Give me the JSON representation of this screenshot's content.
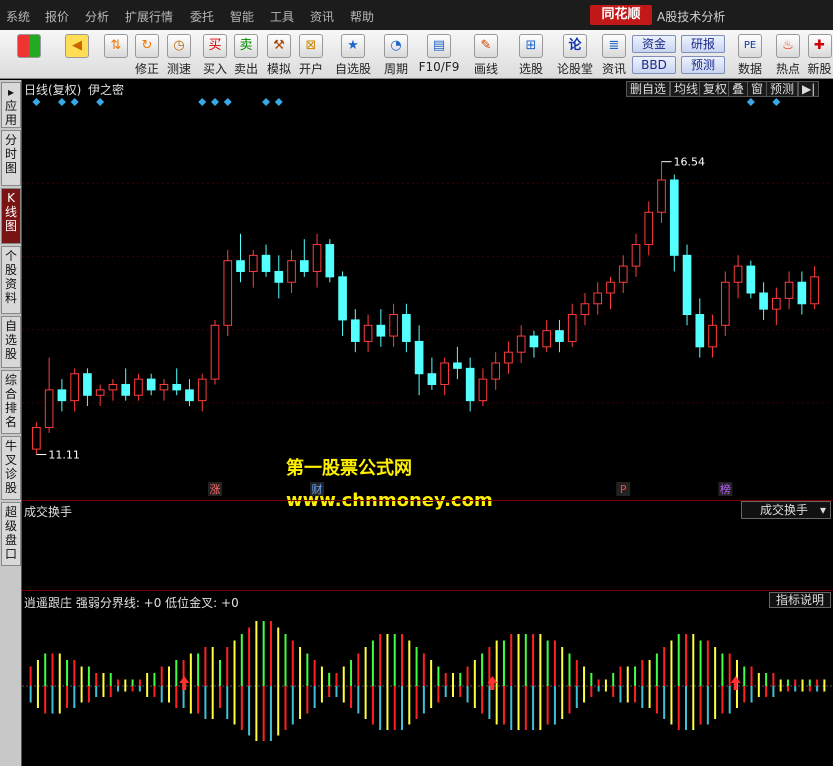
{
  "menu": [
    "系统",
    "报价",
    "分析",
    "扩展行情",
    "委托",
    "智能",
    "工具",
    "资讯",
    "帮助"
  ],
  "brand": "同花顺",
  "app_title": "A股技术分析",
  "toolbar": {
    "buttons": [
      {
        "label": "",
        "icon": "grid-icon"
      },
      {
        "label": "",
        "icon": "back-arrow-icon"
      },
      {
        "label": "",
        "icon": "up-down-icon"
      },
      {
        "label": "修正",
        "icon": "fix-icon"
      },
      {
        "label": "测速",
        "icon": "clock-icon"
      },
      {
        "label": "买入",
        "icon": "buy-icon"
      },
      {
        "label": "卖出",
        "icon": "sell-icon"
      },
      {
        "label": "模拟",
        "icon": "hammer-icon"
      },
      {
        "label": "开户",
        "icon": "lock-icon"
      },
      {
        "label": "自选股",
        "icon": "star-icon"
      },
      {
        "label": "周期",
        "icon": "cycle-icon"
      },
      {
        "label": "F10/F9",
        "icon": "f10-icon"
      },
      {
        "label": "画线",
        "icon": "pen-icon"
      },
      {
        "label": "选股",
        "icon": "select-icon"
      },
      {
        "label": "论股堂",
        "icon": "forum-icon"
      },
      {
        "label": "资讯",
        "icon": "news-icon"
      },
      {
        "label": "数据",
        "icon": "pe-icon"
      },
      {
        "label": "热点",
        "icon": "hot-icon"
      },
      {
        "label": "新股",
        "icon": "new-icon"
      }
    ],
    "small": {
      "fund": "资金",
      "research": "研报",
      "bbd": "BBD",
      "forecast": "预测"
    },
    "icon_glyphs": {
      "buy": "买",
      "sell": "卖",
      "pe": "PE",
      "forum": "论"
    }
  },
  "sidebar": [
    {
      "label": "▸应用",
      "active": false
    },
    {
      "label": "分时图",
      "active": false
    },
    {
      "label": "K线图",
      "active": true
    },
    {
      "label": "个股资料",
      "active": false
    },
    {
      "label": "自选股",
      "active": false
    },
    {
      "label": "综合排名",
      "active": false
    },
    {
      "label": "牛叉诊股",
      "active": false
    },
    {
      "label": "超级盘口",
      "active": false
    }
  ],
  "kline": {
    "title": "日线(复权)",
    "indicator": "伊之密",
    "buttons": [
      "删自选",
      "均线",
      "复权",
      "叠",
      "窗",
      "预测",
      "▶|"
    ],
    "high_label": "16.54",
    "low_label": "11.11",
    "y_range": [
      10.7,
      17.5
    ],
    "events": [
      {
        "text": "涨",
        "color": "#ff6a6a",
        "idx": 14
      },
      {
        "text": "财",
        "color": "#6aa6ff",
        "idx": 22
      },
      {
        "text": "P",
        "color": "#ff4040",
        "idx": 46
      },
      {
        "text": "榜",
        "color": "#c060ff",
        "idx": 54
      }
    ],
    "candles": [
      [
        11.2,
        11.7,
        11.1,
        11.6
      ],
      [
        11.6,
        12.9,
        11.5,
        12.3
      ],
      [
        12.3,
        12.5,
        11.9,
        12.1
      ],
      [
        12.1,
        12.7,
        11.9,
        12.6
      ],
      [
        12.6,
        12.7,
        12.0,
        12.2
      ],
      [
        12.2,
        12.4,
        12.0,
        12.3
      ],
      [
        12.3,
        12.5,
        12.1,
        12.4
      ],
      [
        12.4,
        12.7,
        12.1,
        12.2
      ],
      [
        12.2,
        12.6,
        12.1,
        12.5
      ],
      [
        12.5,
        12.6,
        12.2,
        12.3
      ],
      [
        12.3,
        12.5,
        12.1,
        12.4
      ],
      [
        12.4,
        12.7,
        12.2,
        12.3
      ],
      [
        12.3,
        12.5,
        12.0,
        12.1
      ],
      [
        12.1,
        12.6,
        11.9,
        12.5
      ],
      [
        12.5,
        13.6,
        12.4,
        13.5
      ],
      [
        13.5,
        14.9,
        13.3,
        14.7
      ],
      [
        14.7,
        15.2,
        14.3,
        14.5
      ],
      [
        14.5,
        14.9,
        14.2,
        14.8
      ],
      [
        14.8,
        15.0,
        14.4,
        14.5
      ],
      [
        14.5,
        14.8,
        14.0,
        14.3
      ],
      [
        14.3,
        14.9,
        14.1,
        14.7
      ],
      [
        14.7,
        15.1,
        14.4,
        14.5
      ],
      [
        14.5,
        15.2,
        14.2,
        15.0
      ],
      [
        15.0,
        15.1,
        14.3,
        14.4
      ],
      [
        14.4,
        14.5,
        13.3,
        13.6
      ],
      [
        13.6,
        13.8,
        13.0,
        13.2
      ],
      [
        13.2,
        13.7,
        13.0,
        13.5
      ],
      [
        13.5,
        13.8,
        13.1,
        13.3
      ],
      [
        13.3,
        13.9,
        13.1,
        13.7
      ],
      [
        13.7,
        13.9,
        13.0,
        13.2
      ],
      [
        13.2,
        13.5,
        12.2,
        12.6
      ],
      [
        12.6,
        12.9,
        12.3,
        12.4
      ],
      [
        12.4,
        12.9,
        12.2,
        12.8
      ],
      [
        12.8,
        13.1,
        12.5,
        12.7
      ],
      [
        12.7,
        12.9,
        11.9,
        12.1
      ],
      [
        12.1,
        12.7,
        12.0,
        12.5
      ],
      [
        12.5,
        13.0,
        12.3,
        12.8
      ],
      [
        12.8,
        13.2,
        12.6,
        13.0
      ],
      [
        13.0,
        13.5,
        12.8,
        13.3
      ],
      [
        13.3,
        13.4,
        12.9,
        13.1
      ],
      [
        13.1,
        13.6,
        13.0,
        13.4
      ],
      [
        13.4,
        13.6,
        13.0,
        13.2
      ],
      [
        13.2,
        13.9,
        13.1,
        13.7
      ],
      [
        13.7,
        14.1,
        13.5,
        13.9
      ],
      [
        13.9,
        14.3,
        13.7,
        14.1
      ],
      [
        14.1,
        14.4,
        13.8,
        14.3
      ],
      [
        14.3,
        14.8,
        14.1,
        14.6
      ],
      [
        14.6,
        15.2,
        14.4,
        15.0
      ],
      [
        15.0,
        15.8,
        14.8,
        15.6
      ],
      [
        15.6,
        16.54,
        15.4,
        16.2
      ],
      [
        16.2,
        16.3,
        14.5,
        14.8
      ],
      [
        14.8,
        15.0,
        13.5,
        13.7
      ],
      [
        13.7,
        14.0,
        12.9,
        13.1
      ],
      [
        13.1,
        13.7,
        12.9,
        13.5
      ],
      [
        13.5,
        14.5,
        13.3,
        14.3
      ],
      [
        14.3,
        14.8,
        14.0,
        14.6
      ],
      [
        14.6,
        14.7,
        14.0,
        14.1
      ],
      [
        14.1,
        14.3,
        13.6,
        13.8
      ],
      [
        13.8,
        14.2,
        13.5,
        14.0
      ],
      [
        14.0,
        14.5,
        13.8,
        14.3
      ],
      [
        14.3,
        14.5,
        13.7,
        13.9
      ],
      [
        13.9,
        14.6,
        13.8,
        14.4
      ]
    ],
    "markers": [
      0,
      2,
      3,
      5,
      13,
      14,
      15,
      18,
      19,
      56,
      58
    ]
  },
  "watermark": {
    "line1": "第一股票公式网",
    "line2": "www.chnmoney.com"
  },
  "volume_panel": {
    "label": "成交换手",
    "dropdown": "成交换手"
  },
  "indicator_panel": {
    "label": "逍遥跟庄 强弱分界线: +0 低位金叉: +0",
    "help": "指标说明",
    "histogram": [
      3,
      4,
      5,
      5,
      5,
      4,
      4,
      3,
      3,
      2,
      2,
      2,
      1,
      1,
      1,
      1,
      2,
      2,
      3,
      3,
      4,
      4,
      5,
      5,
      6,
      6,
      4,
      6,
      7,
      8,
      9,
      10,
      10,
      10,
      9,
      8,
      7,
      6,
      5,
      4,
      3,
      2,
      2,
      3,
      4,
      5,
      6,
      7,
      8,
      8,
      8,
      8,
      7,
      6,
      5,
      4,
      3,
      2,
      2,
      2,
      3,
      4,
      5,
      6,
      7,
      7,
      8,
      8,
      8,
      8,
      8,
      7,
      7,
      6,
      5,
      4,
      3,
      2,
      1,
      1,
      2,
      3,
      3,
      3,
      4,
      4,
      5,
      6,
      7,
      8,
      8,
      8,
      7,
      7,
      6,
      5,
      5,
      4,
      3,
      3,
      2,
      2,
      2,
      1,
      1,
      1,
      1,
      1,
      1,
      1
    ],
    "colors_pos": [
      "#ff2020",
      "#ffff40",
      "#40ff40"
    ],
    "colors_neg": [
      "#40c0d8",
      "#ffff40",
      "#ff2020"
    ]
  }
}
